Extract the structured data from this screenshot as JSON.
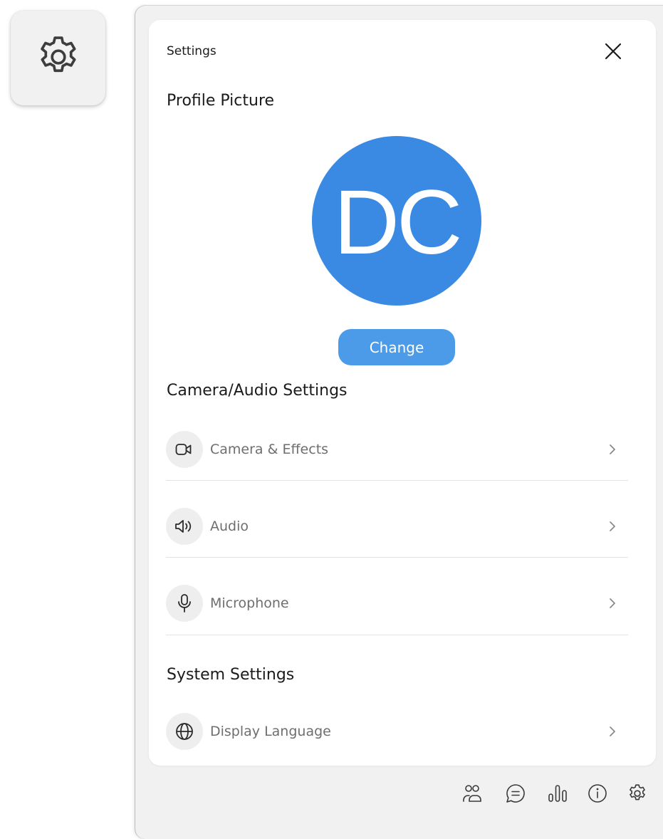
{
  "panel": {
    "title": "Settings",
    "profile_heading": "Profile Picture",
    "avatar_initials": "DC",
    "avatar_color": "#3a8ae3",
    "change_label": "Change",
    "camera_audio_heading": "Camera/Audio Settings",
    "system_heading": "System Settings"
  },
  "rows": [
    {
      "label": "Camera & Effects",
      "icon": "video-camera-icon"
    },
    {
      "label": "Audio",
      "icon": "speaker-icon"
    },
    {
      "label": "Microphone",
      "icon": "microphone-icon"
    },
    {
      "label": "Display Language",
      "icon": "globe-icon"
    }
  ],
  "footer_icons": [
    "participants-icon",
    "chat-icon",
    "stats-icon",
    "info-icon",
    "settings-gear-icon"
  ],
  "colors": {
    "accent": "#4b9be8",
    "text_primary": "#1b1b1b",
    "text_secondary": "#6e6e6e"
  }
}
